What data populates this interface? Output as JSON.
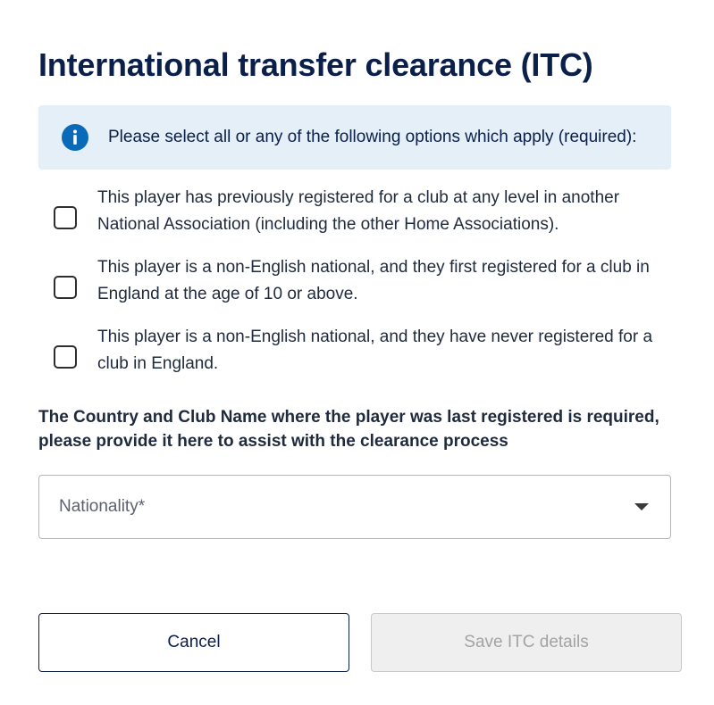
{
  "title": "International transfer clearance (ITC)",
  "info": {
    "icon": "info-icon",
    "text": "Please select all or any of the following options which apply (required):",
    "icon_color": "#0b6ab8",
    "background": "#e4eff7"
  },
  "options": [
    {
      "label": "This player has previously registered for a club at any level in another National Association (including the other Home Associations).",
      "checked": false
    },
    {
      "label": "This player is a non-English national, and they first registered for a club in England at the age of 10 or above.",
      "checked": false
    },
    {
      "label": "This player is a non-English national, and they have never registered for a club in England.",
      "checked": false
    }
  ],
  "club_note": "The Country and Club Name where the player was last registered is required, please provide it here to assist with the clearance process",
  "nationality": {
    "placeholder": "Nationality*",
    "value": "",
    "icon": "chevron-down-icon"
  },
  "buttons": {
    "cancel_label": "Cancel",
    "save_label": "Save ITC details",
    "save_disabled": true
  },
  "colors": {
    "heading": "#0b1f4b",
    "text": "#1f2a3d"
  }
}
